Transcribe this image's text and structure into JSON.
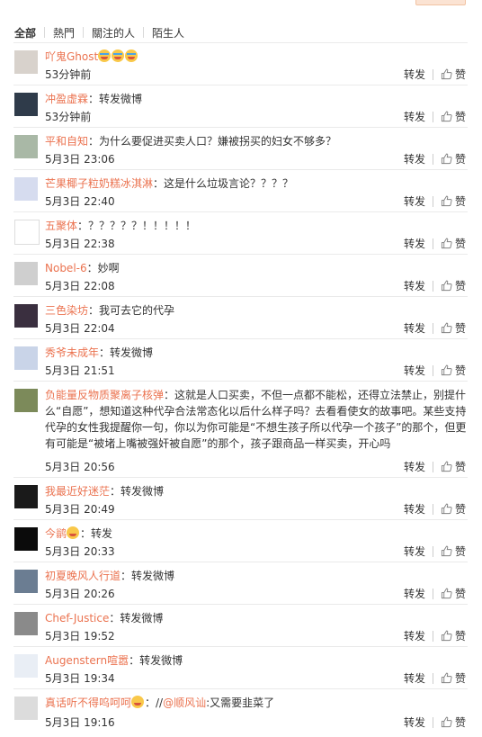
{
  "tabs": [
    "全部",
    "熱門",
    "關注的人",
    "陌生人"
  ],
  "actions": {
    "forward": "转发",
    "like": "赞"
  },
  "comments": [
    {
      "user": "吖鬼Ghost",
      "sep": "",
      "text": "",
      "emojis": 3,
      "time": "53分钟前"
    },
    {
      "user": "冲盈虚霖",
      "sep": "：",
      "text": "转发微博",
      "emojis": 0,
      "time": "53分钟前"
    },
    {
      "user": "平和自知",
      "sep": "：",
      "text": "为什么要促进买卖人口？嫌被拐买的妇女不够多？",
      "emojis": 0,
      "time": "5月3日 23:06"
    },
    {
      "user": "芒果椰子粒奶糕冰淇淋",
      "sep": "：",
      "text": "这是什么垃圾言论？？？？",
      "emojis": 0,
      "time": "5月3日 22:40"
    },
    {
      "user": "五聚体",
      "sep": "：",
      "text": "？？？？？！！！！！",
      "emojis": 0,
      "time": "5月3日 22:38"
    },
    {
      "user": "Nobel-6",
      "sep": "：",
      "text": "妙啊",
      "emojis": 0,
      "time": "5月3日 22:08"
    },
    {
      "user": "三色染坊",
      "sep": "：",
      "text": "我可去它的代孕",
      "emojis": 0,
      "time": "5月3日 22:04"
    },
    {
      "user": "秀爷未成年",
      "sep": "：",
      "text": "转发微博",
      "emojis": 0,
      "time": "5月3日 21:51"
    },
    {
      "user": "负能量反物质聚离子核弹",
      "sep": "：",
      "text": "这就是人口买卖，不但一点都不能松，还得立法禁止，别提什么“自愿”，想知道这种代孕合法常态化以后什么样子吗？去看看使女的故事吧。某些支持代孕的女性我提醒你一句，你以为你可能是“不想生孩子所以代孕一个孩子”的那个，但更有可能是“被堵上嘴被强奸被自愿”的那个，孩子跟商品一样买卖，开心吗",
      "emojis": 0,
      "time": "5月3日 20:56"
    },
    {
      "user": "我最近好迷茫",
      "sep": "：",
      "text": "转发微博",
      "emojis": 0,
      "time": "5月3日 20:49"
    },
    {
      "user": "今鹟",
      "sep": "",
      "text": "：转发",
      "emojis": 1,
      "time": "5月3日 20:33"
    },
    {
      "user": "初夏晚风人行道",
      "sep": "：",
      "text": "转发微博",
      "emojis": 0,
      "time": "5月3日 20:26"
    },
    {
      "user": "Chef-Justice",
      "sep": "：",
      "text": "转发微博",
      "emojis": 0,
      "time": "5月3日 19:52"
    },
    {
      "user": "Augenstern喧嚣",
      "sep": "：",
      "text": "转发微博",
      "emojis": 0,
      "time": "5月3日 19:34"
    },
    {
      "user": "真话听不得呜呵呵",
      "sep": "",
      "text": "：//",
      "mention": "@顺风讪",
      "after": ":又需要韭菜了",
      "emojis": 1,
      "time": "5月3日 19:16"
    }
  ],
  "colors": {
    "username": "#eb7350",
    "text": "#333333",
    "divider": "#eaeaea"
  }
}
